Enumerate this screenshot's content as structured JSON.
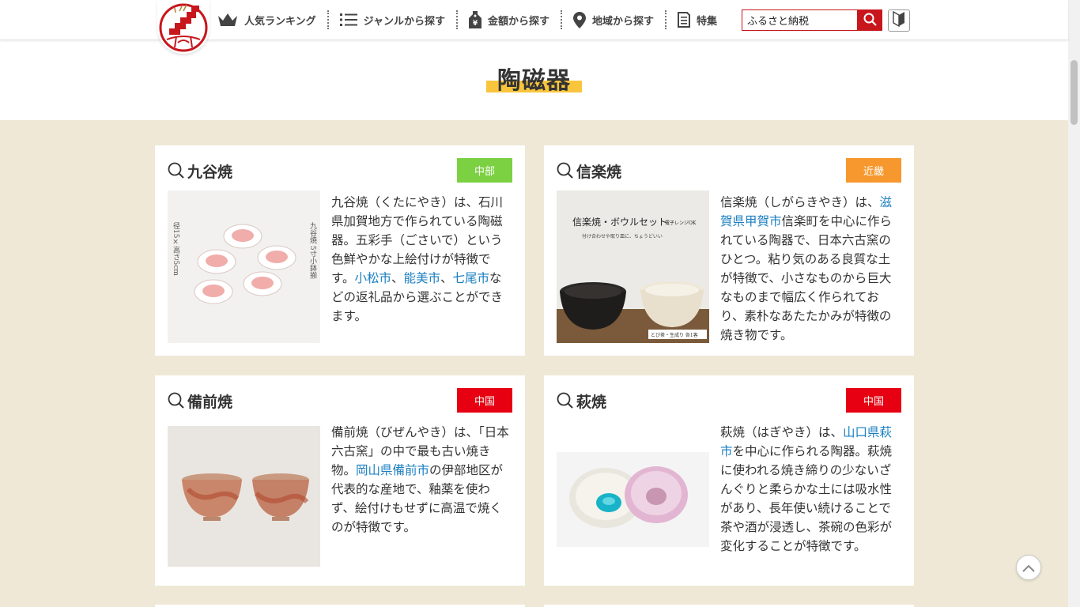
{
  "header": {
    "nav": [
      {
        "label": "人気ランキング",
        "icon": "crown-icon"
      },
      {
        "label": "ジャンルから探す",
        "icon": "list-icon"
      },
      {
        "label": "金額から探す",
        "icon": "price-tag-icon"
      },
      {
        "label": "地域から探す",
        "icon": "map-pin-icon"
      },
      {
        "label": "特集",
        "icon": "document-icon"
      }
    ],
    "search": {
      "value": "ふるさと納税"
    }
  },
  "page": {
    "title": "陶磁器"
  },
  "colors": {
    "brand_red": "#c8161d",
    "chubu": "#7cd143",
    "kinki": "#f7982e",
    "chugoku": "#e60012",
    "title_accent": "#f9c53d",
    "background": "#efe8d6",
    "link": "#1a7fc1"
  },
  "cards": [
    {
      "title": "九谷焼",
      "region": "中部",
      "image_alt": "九谷焼 5寸小鉢揃",
      "text_parts": [
        "九谷焼（くたにやき）は、石川県加賀地方で作られている陶磁器。五彩手（ごさいで）という色鮮やかな上絵付けが特徴です。",
        "小松市",
        "、",
        "能美市",
        "、",
        "七尾市",
        "などの返礼品から選ぶことができます。"
      ]
    },
    {
      "title": "信楽焼",
      "region": "近畿",
      "image_caption": "信楽焼・ボウルセット",
      "image_caption_sub": "電子レンジOK",
      "image_subtitle": "付け合わせや取り皿に、ちょうどいい",
      "image_tag": "とび茶・生成り 各1客",
      "text_parts": [
        "信楽焼（しがらきやき）は、",
        "滋賀県甲賀市",
        "信楽町を中心に作られている陶器で、日本六古窯のひとつ。粘り気のある良質な土が特徴で、小さなものから巨大なものまで幅広く作られており、素朴なあたたかみが特徴の焼き物です。"
      ]
    },
    {
      "title": "備前焼",
      "region": "中国",
      "text_parts": [
        "備前焼（びぜんやき）は、「日本六古窯」の中で最も古い焼き物。",
        "岡山県備前市",
        "の伊部地区が代表的な産地で、釉薬を使わず、絵付けもせずに高温で焼くのが特徴です。"
      ]
    },
    {
      "title": "萩焼",
      "region": "中国",
      "text_parts": [
        "萩焼（はぎやき）は、",
        "山口県萩市",
        "を中心に作られる陶器。萩焼に使われる焼き締りの少ないざんぐりと柔らかな土には吸水性があり、長年使い続けることで茶や酒が浸透し、茶碗の色彩が変化することが特徴です。"
      ]
    }
  ]
}
